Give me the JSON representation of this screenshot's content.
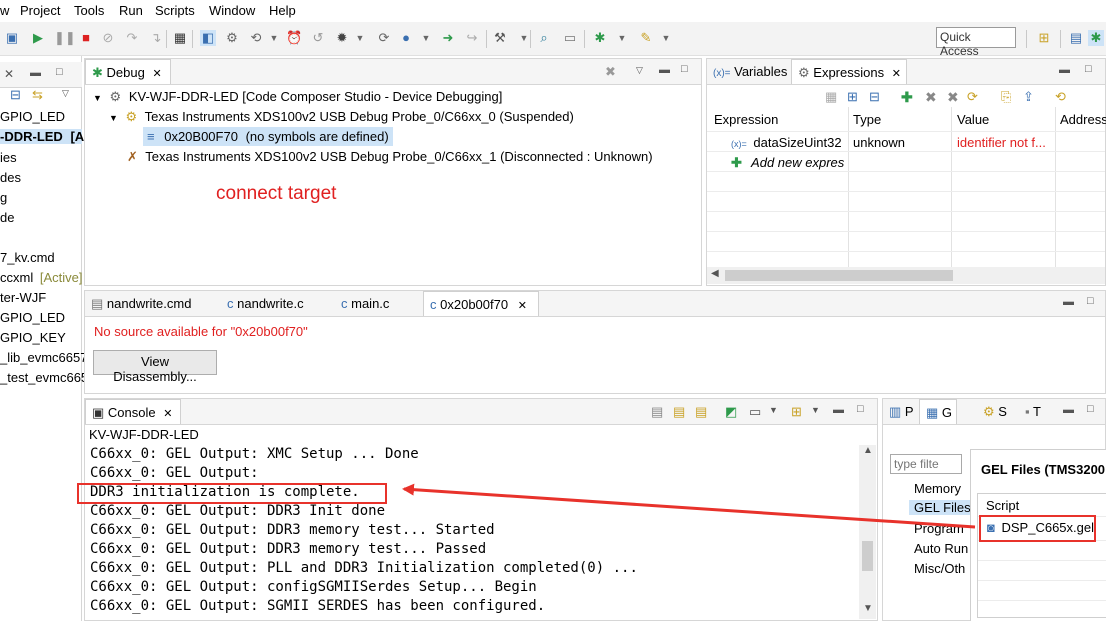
{
  "menu": [
    "w",
    "Project",
    "Tools",
    "Run",
    "Scripts",
    "Window",
    "Help"
  ],
  "toolbar": {
    "quick_access": "Quick Access"
  },
  "left_tree": {
    "items": [
      "GPIO_LED",
      "-DDR-LED",
      "[A",
      "ies",
      "des",
      "g",
      "de",
      "7_kv.cmd",
      "ccxml",
      "[Active]",
      "ter-WJF",
      "GPIO_LED",
      "GPIO_KEY",
      "_lib_evmc6657",
      "_test_evmc665"
    ]
  },
  "debug": {
    "tab": "Debug",
    "root": "KV-WJF-DDR-LED [Code Composer Studio - Device Debugging]",
    "probe0": "Texas Instruments XDS100v2 USB Debug Probe_0/C66xx_0 (Suspended)",
    "frame": "0x20B00F70",
    "frame_note": "(no symbols are defined)",
    "probe1": "Texas Instruments XDS100v2 USB Debug Probe_0/C66xx_1 (Disconnected : Unknown)",
    "annotation": "connect target"
  },
  "expressions": {
    "tab_variables": "Variables",
    "tab_expressions": "Expressions",
    "variables_prefix": "(x)=",
    "headers": [
      "Expression",
      "Type",
      "Value",
      "Address"
    ],
    "row_name": "dataSizeUint32",
    "row_type": "unknown",
    "row_value": "identifier not f...",
    "add_new": "Add new expres"
  },
  "editor": {
    "tabs": [
      "nandwrite.cmd",
      "nandwrite.c",
      "main.c",
      "0x20b00f70"
    ],
    "no_source": "No source available for \"0x20b00f70\"",
    "view_disassembly": "View Disassembly..."
  },
  "console": {
    "tab": "Console",
    "session": "KV-WJF-DDR-LED",
    "lines": [
      "C66xx_0: GEL Output: XMC Setup ... Done",
      "C66xx_0: GEL Output:",
      "DDR3 initialization is complete.",
      "C66xx_0: GEL Output: DDR3 Init done",
      "C66xx_0: GEL Output: DDR3 memory test... Started",
      "C66xx_0: GEL Output: DDR3 memory test... Passed",
      "C66xx_0: GEL Output: PLL and DDR3 Initialization completed(0) ...",
      "C66xx_0: GEL Output: configSGMIISerdes Setup... Begin",
      "C66xx_0: GEL Output: SGMII SERDES has been configured."
    ]
  },
  "gel": {
    "tabs": [
      "P",
      "G",
      "S",
      "T"
    ],
    "filter_placeholder": "type filte",
    "categories": [
      "Memory",
      "GEL Files",
      "Program",
      "Auto Run",
      "Misc/Oth"
    ],
    "panel_title": "GEL Files (TMS3200",
    "script_header": "Script",
    "script_file": "DSP_C665x.gel"
  },
  "colors": {
    "accent_red": "#e8322b",
    "selection": "#cde3f7"
  }
}
